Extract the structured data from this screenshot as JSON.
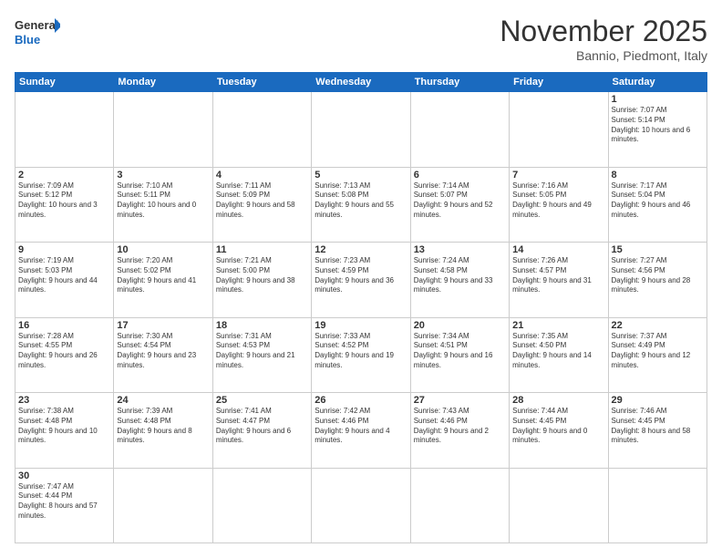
{
  "header": {
    "logo_general": "General",
    "logo_blue": "Blue",
    "month_title": "November 2025",
    "location": "Bannio, Piedmont, Italy"
  },
  "days_of_week": [
    "Sunday",
    "Monday",
    "Tuesday",
    "Wednesday",
    "Thursday",
    "Friday",
    "Saturday"
  ],
  "weeks": [
    [
      {
        "num": "",
        "info": ""
      },
      {
        "num": "",
        "info": ""
      },
      {
        "num": "",
        "info": ""
      },
      {
        "num": "",
        "info": ""
      },
      {
        "num": "",
        "info": ""
      },
      {
        "num": "",
        "info": ""
      },
      {
        "num": "1",
        "info": "Sunrise: 7:07 AM\nSunset: 5:14 PM\nDaylight: 10 hours and 6 minutes."
      }
    ],
    [
      {
        "num": "2",
        "info": "Sunrise: 7:09 AM\nSunset: 5:12 PM\nDaylight: 10 hours and 3 minutes."
      },
      {
        "num": "3",
        "info": "Sunrise: 7:10 AM\nSunset: 5:11 PM\nDaylight: 10 hours and 0 minutes."
      },
      {
        "num": "4",
        "info": "Sunrise: 7:11 AM\nSunset: 5:09 PM\nDaylight: 9 hours and 58 minutes."
      },
      {
        "num": "5",
        "info": "Sunrise: 7:13 AM\nSunset: 5:08 PM\nDaylight: 9 hours and 55 minutes."
      },
      {
        "num": "6",
        "info": "Sunrise: 7:14 AM\nSunset: 5:07 PM\nDaylight: 9 hours and 52 minutes."
      },
      {
        "num": "7",
        "info": "Sunrise: 7:16 AM\nSunset: 5:05 PM\nDaylight: 9 hours and 49 minutes."
      },
      {
        "num": "8",
        "info": "Sunrise: 7:17 AM\nSunset: 5:04 PM\nDaylight: 9 hours and 46 minutes."
      }
    ],
    [
      {
        "num": "9",
        "info": "Sunrise: 7:19 AM\nSunset: 5:03 PM\nDaylight: 9 hours and 44 minutes."
      },
      {
        "num": "10",
        "info": "Sunrise: 7:20 AM\nSunset: 5:02 PM\nDaylight: 9 hours and 41 minutes."
      },
      {
        "num": "11",
        "info": "Sunrise: 7:21 AM\nSunset: 5:00 PM\nDaylight: 9 hours and 38 minutes."
      },
      {
        "num": "12",
        "info": "Sunrise: 7:23 AM\nSunset: 4:59 PM\nDaylight: 9 hours and 36 minutes."
      },
      {
        "num": "13",
        "info": "Sunrise: 7:24 AM\nSunset: 4:58 PM\nDaylight: 9 hours and 33 minutes."
      },
      {
        "num": "14",
        "info": "Sunrise: 7:26 AM\nSunset: 4:57 PM\nDaylight: 9 hours and 31 minutes."
      },
      {
        "num": "15",
        "info": "Sunrise: 7:27 AM\nSunset: 4:56 PM\nDaylight: 9 hours and 28 minutes."
      }
    ],
    [
      {
        "num": "16",
        "info": "Sunrise: 7:28 AM\nSunset: 4:55 PM\nDaylight: 9 hours and 26 minutes."
      },
      {
        "num": "17",
        "info": "Sunrise: 7:30 AM\nSunset: 4:54 PM\nDaylight: 9 hours and 23 minutes."
      },
      {
        "num": "18",
        "info": "Sunrise: 7:31 AM\nSunset: 4:53 PM\nDaylight: 9 hours and 21 minutes."
      },
      {
        "num": "19",
        "info": "Sunrise: 7:33 AM\nSunset: 4:52 PM\nDaylight: 9 hours and 19 minutes."
      },
      {
        "num": "20",
        "info": "Sunrise: 7:34 AM\nSunset: 4:51 PM\nDaylight: 9 hours and 16 minutes."
      },
      {
        "num": "21",
        "info": "Sunrise: 7:35 AM\nSunset: 4:50 PM\nDaylight: 9 hours and 14 minutes."
      },
      {
        "num": "22",
        "info": "Sunrise: 7:37 AM\nSunset: 4:49 PM\nDaylight: 9 hours and 12 minutes."
      }
    ],
    [
      {
        "num": "23",
        "info": "Sunrise: 7:38 AM\nSunset: 4:48 PM\nDaylight: 9 hours and 10 minutes."
      },
      {
        "num": "24",
        "info": "Sunrise: 7:39 AM\nSunset: 4:48 PM\nDaylight: 9 hours and 8 minutes."
      },
      {
        "num": "25",
        "info": "Sunrise: 7:41 AM\nSunset: 4:47 PM\nDaylight: 9 hours and 6 minutes."
      },
      {
        "num": "26",
        "info": "Sunrise: 7:42 AM\nSunset: 4:46 PM\nDaylight: 9 hours and 4 minutes."
      },
      {
        "num": "27",
        "info": "Sunrise: 7:43 AM\nSunset: 4:46 PM\nDaylight: 9 hours and 2 minutes."
      },
      {
        "num": "28",
        "info": "Sunrise: 7:44 AM\nSunset: 4:45 PM\nDaylight: 9 hours and 0 minutes."
      },
      {
        "num": "29",
        "info": "Sunrise: 7:46 AM\nSunset: 4:45 PM\nDaylight: 8 hours and 58 minutes."
      }
    ],
    [
      {
        "num": "30",
        "info": "Sunrise: 7:47 AM\nSunset: 4:44 PM\nDaylight: 8 hours and 57 minutes."
      },
      {
        "num": "",
        "info": ""
      },
      {
        "num": "",
        "info": ""
      },
      {
        "num": "",
        "info": ""
      },
      {
        "num": "",
        "info": ""
      },
      {
        "num": "",
        "info": ""
      },
      {
        "num": "",
        "info": ""
      }
    ]
  ]
}
